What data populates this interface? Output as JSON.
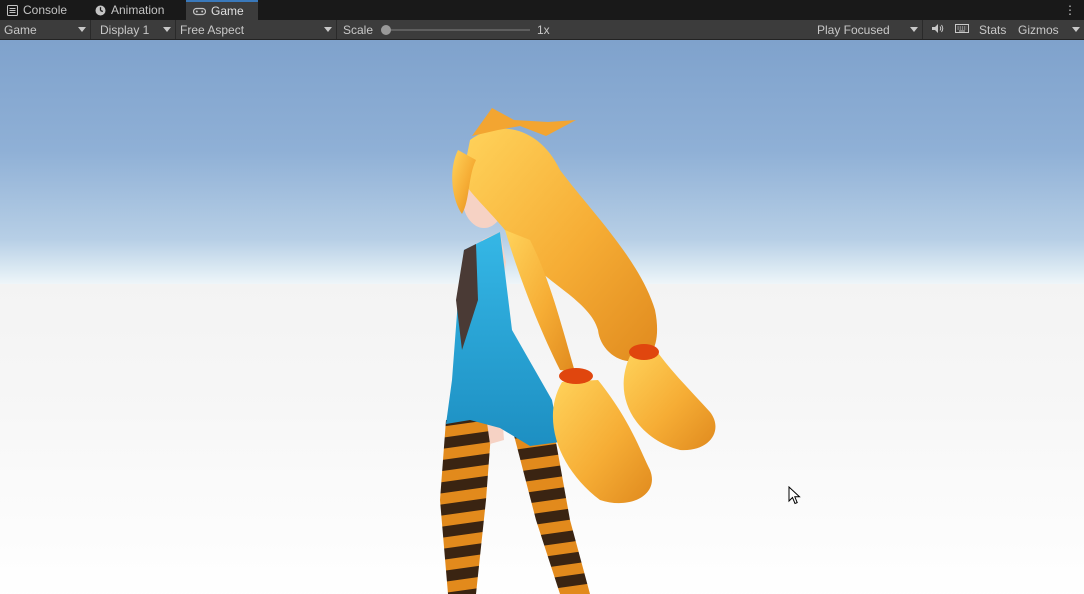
{
  "tabs": [
    {
      "label": "Console",
      "icon": "console-icon",
      "active": false
    },
    {
      "label": "Animation",
      "icon": "clock-icon",
      "active": false
    },
    {
      "label": "Game",
      "icon": "gamepad-icon",
      "active": true
    }
  ],
  "toolbar": {
    "view_mode": "Game",
    "display": "Display 1",
    "aspect": "Free Aspect",
    "scale_label": "Scale",
    "scale_value": "1x",
    "play_mode": "Play Focused",
    "stats_label": "Stats",
    "gizmos_label": "Gizmos"
  },
  "colors": {
    "tab_accent": "#3a79bb",
    "hair": "#f6b23c",
    "dress": "#2aa6d9",
    "stocking_dark": "#3a2412",
    "stocking_light": "#e28a1c"
  }
}
